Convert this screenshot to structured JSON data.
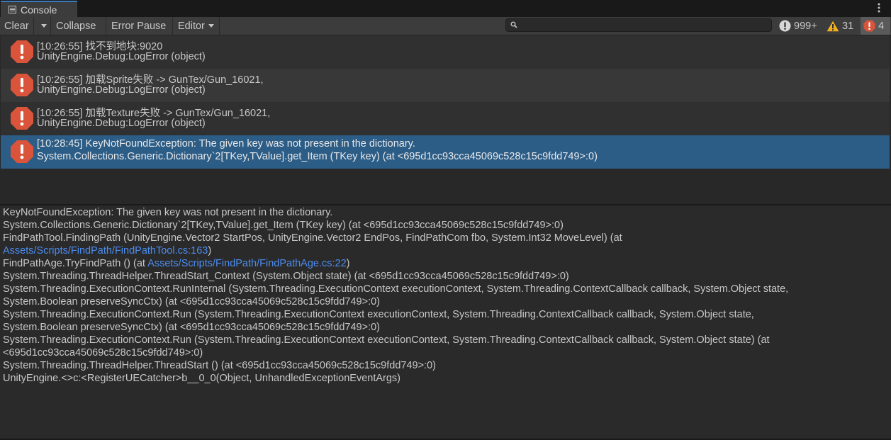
{
  "tab": {
    "label": "Console"
  },
  "toolbar": {
    "clear": "Clear",
    "collapse": "Collapse",
    "error_pause": "Error Pause",
    "editor": "Editor",
    "search_placeholder": "",
    "log_count": "999+",
    "warning_count": "31",
    "error_count": "4"
  },
  "colors": {
    "error_icon": "#d9543a",
    "warning_icon": "#f2b01e",
    "selected_row": "#2c5d87",
    "link": "#4c8df0"
  },
  "logs": [
    {
      "line1": "[10:26:55] 找不到地块:9020",
      "line2": "UnityEngine.Debug:LogError (object)"
    },
    {
      "line1": "[10:26:55] 加载Sprite失败 -> GunTex/Gun_16021,",
      "line2": "UnityEngine.Debug:LogError (object)"
    },
    {
      "line1": "[10:26:55] 加载Texture失败 -> GunTex/Gun_16021,",
      "line2": "UnityEngine.Debug:LogError (object)"
    },
    {
      "line1": "[10:28:45] KeyNotFoundException: The given key was not present in the dictionary.",
      "line2": "System.Collections.Generic.Dictionary`2[TKey,TValue].get_Item (TKey key) (at <695d1cc93cca45069c528c15c9fdd749>:0)"
    }
  ],
  "detail": {
    "l1": "KeyNotFoundException: The given key was not present in the dictionary.",
    "l2": "System.Collections.Generic.Dictionary`2[TKey,TValue].get_Item (TKey key) (at <695d1cc93cca45069c528c15c9fdd749>:0)",
    "l3": "FindPathTool.FindingPath (UnityEngine.Vector2 StartPos, UnityEngine.Vector2 EndPos, FindPathCom fbo, System.Int32 MoveLevel) (at",
    "l4_link": "Assets/Scripts/FindPath/FindPathTool.cs:163",
    "l4_suffix": ")",
    "l5_prefix": "FindPathAge.TryFindPath () (at ",
    "l5_link": "Assets/Scripts/FindPath/FindPathAge.cs:22",
    "l5_suffix": ")",
    "l6": "System.Threading.ThreadHelper.ThreadStart_Context (System.Object state) (at <695d1cc93cca45069c528c15c9fdd749>:0)",
    "l7": "System.Threading.ExecutionContext.RunInternal (System.Threading.ExecutionContext executionContext, System.Threading.ContextCallback callback, System.Object state,",
    "l8": "System.Boolean preserveSyncCtx) (at <695d1cc93cca45069c528c15c9fdd749>:0)",
    "l9": "System.Threading.ExecutionContext.Run (System.Threading.ExecutionContext executionContext, System.Threading.ContextCallback callback, System.Object state,",
    "l10": "System.Boolean preserveSyncCtx) (at <695d1cc93cca45069c528c15c9fdd749>:0)",
    "l11": "System.Threading.ExecutionContext.Run (System.Threading.ExecutionContext executionContext, System.Threading.ContextCallback callback, System.Object state) (at",
    "l12": "<695d1cc93cca45069c528c15c9fdd749>:0)",
    "l13": "System.Threading.ThreadHelper.ThreadStart () (at <695d1cc93cca45069c528c15c9fdd749>:0)",
    "l14": "UnityEngine.<>c:<RegisterUECatcher>b__0_0(Object, UnhandledExceptionEventArgs)"
  }
}
